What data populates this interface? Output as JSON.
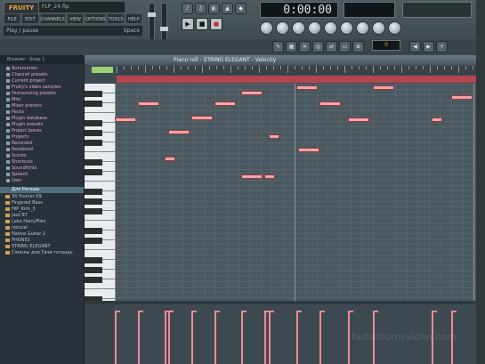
{
  "app": {
    "logo": "FRUITY",
    "song_title": "FLP_24.flp"
  },
  "menu": [
    "FILE",
    "EDIT",
    "CHANNELS",
    "VIEW",
    "OPTIONS",
    "TOOLS",
    "HELP"
  ],
  "hint_bar": {
    "left": "Play / pause",
    "right": "Space"
  },
  "time_display": "0:00:00",
  "pattern_display": "0",
  "transport": {
    "play": "▶",
    "stop": "■",
    "rec": "●"
  },
  "browser": {
    "header": "Browser · Snap 1",
    "folders": [
      "Automation",
      "Channel presets",
      "Current project",
      "Fruity's video samples",
      "Humanizing presets",
      "Misc",
      "Mixer presets",
      "Packs",
      "Plugin database",
      "Plugin presets",
      "Project bones",
      "Projects",
      "Recorded",
      "Rendered",
      "Scores",
      "Shortcuts",
      "Soundfonts",
      "Speech",
      "User"
    ],
    "section": "Для Регише",
    "files": [
      "3X Fourier 09",
      "Fingered Bass",
      "HIP_Kick_3",
      "Jazz BT",
      "Lake Hans/Files",
      "natural",
      "Native Guitar 2",
      "PHONES",
      "STRING ELEGANT",
      "Сэмплы для Тачи тетрадь"
    ]
  },
  "piano_roll": {
    "title": "Piano roll - STRING ELEGANT - Velocity"
  },
  "watermark": "fastalbumsvideo.com",
  "colors": {
    "note": "#f3a4a8",
    "velocity": "#f08a95",
    "top_bar": "#b24550"
  }
}
